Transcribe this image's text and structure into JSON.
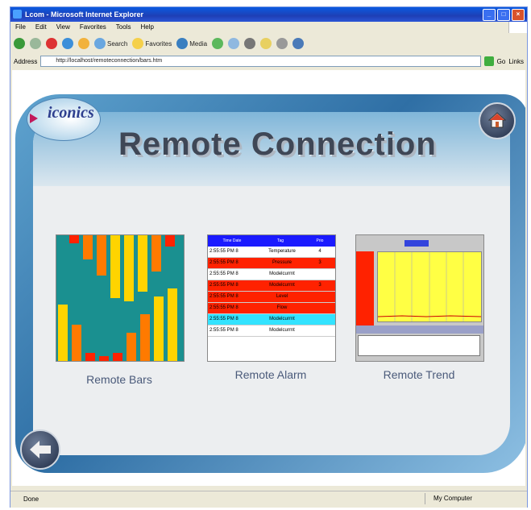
{
  "window": {
    "title": "Lcom - Microsoft Internet Explorer",
    "menu": [
      "File",
      "Edit",
      "View",
      "Favorites",
      "Tools",
      "Help"
    ],
    "toolbar": {
      "search": "Search",
      "favorites": "Favorites",
      "media": "Media"
    },
    "address_label": "Address",
    "address_value": "http://localhost/remoteconnection/bars.htm",
    "go_label": "Go",
    "links_label": "Links",
    "status_left": "Done",
    "status_zone": "My Computer"
  },
  "page": {
    "logo_text": "iconics",
    "title": "Remote Connection",
    "items": [
      {
        "label": "Remote Bars"
      },
      {
        "label": "Remote Alarm"
      },
      {
        "label": "Remote Trend"
      }
    ]
  },
  "alarm": {
    "headers": [
      "Time Date",
      "Tag",
      "Prio"
    ],
    "rows": [
      {
        "text": "2:55:55 PM 8",
        "tag": "Temperature",
        "prio": "4",
        "color": "#ffffff"
      },
      {
        "text": "2:55:55 PM 8",
        "tag": "Pressure",
        "prio": "3",
        "color": "#ff2200"
      },
      {
        "text": "2:55:55 PM 8",
        "tag": "Modelcurrnt",
        "prio": "",
        "color": "#ffffff"
      },
      {
        "text": "2:55:55 PM 8",
        "tag": "Modelcurrnt",
        "prio": "3",
        "color": "#ff2200"
      },
      {
        "text": "2:55:55 PM 8",
        "tag": "Level",
        "prio": "",
        "color": "#ff2200"
      },
      {
        "text": "2:55:55 PM 8",
        "tag": "Flow",
        "prio": "",
        "color": "#ff2200"
      },
      {
        "text": "2:55:55 PM 8",
        "tag": "Modelcurrnt",
        "prio": "",
        "color": "#33e3ff"
      },
      {
        "text": "2:55:55 PM 8",
        "tag": "Modelcurrnt",
        "prio": "",
        "color": "#ffffff"
      }
    ]
  },
  "colors": {
    "bar_bg": "#1a9090",
    "bar_yellow": "#ffd400",
    "bar_orange": "#ff7a00",
    "bar_red": "#ff2200",
    "trend_plot": "#ffff44"
  }
}
